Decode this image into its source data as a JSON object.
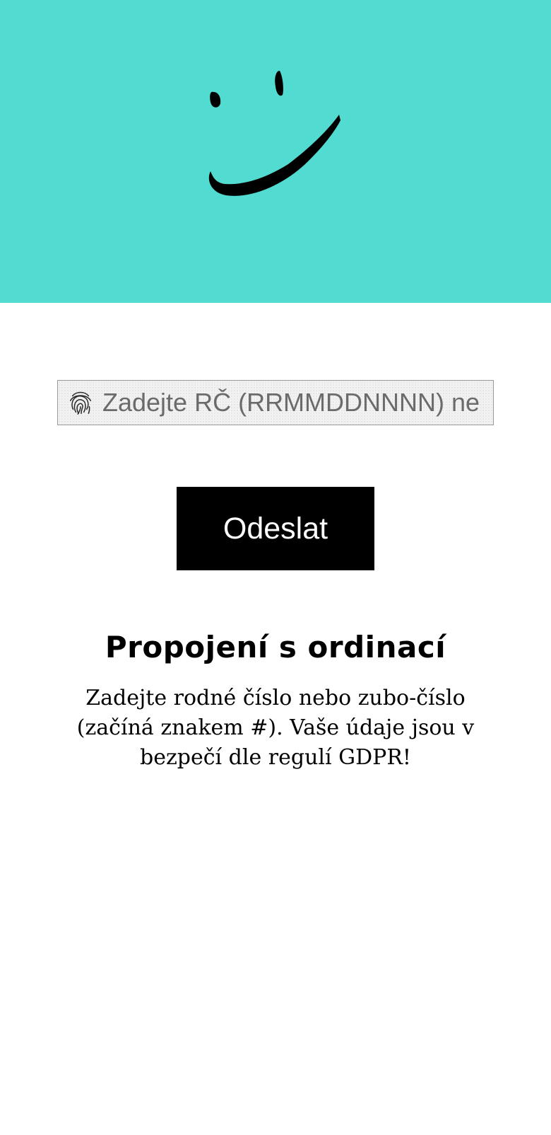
{
  "hero": {
    "background_color": "#52dbd0",
    "logo_icon": "smiley-face-icon"
  },
  "form": {
    "input_icon": "fingerprint-icon",
    "input_placeholder": "Zadejte RČ (RRMMDDNNNN) ne",
    "input_value": "",
    "submit_label": "Odeslat"
  },
  "info": {
    "title": "Propojení s ordinací",
    "description": "Zadejte rodné číslo nebo zubo-číslo (začíná znakem #). Vaše údaje jsou v bezpečí dle regulí GDPR!"
  }
}
